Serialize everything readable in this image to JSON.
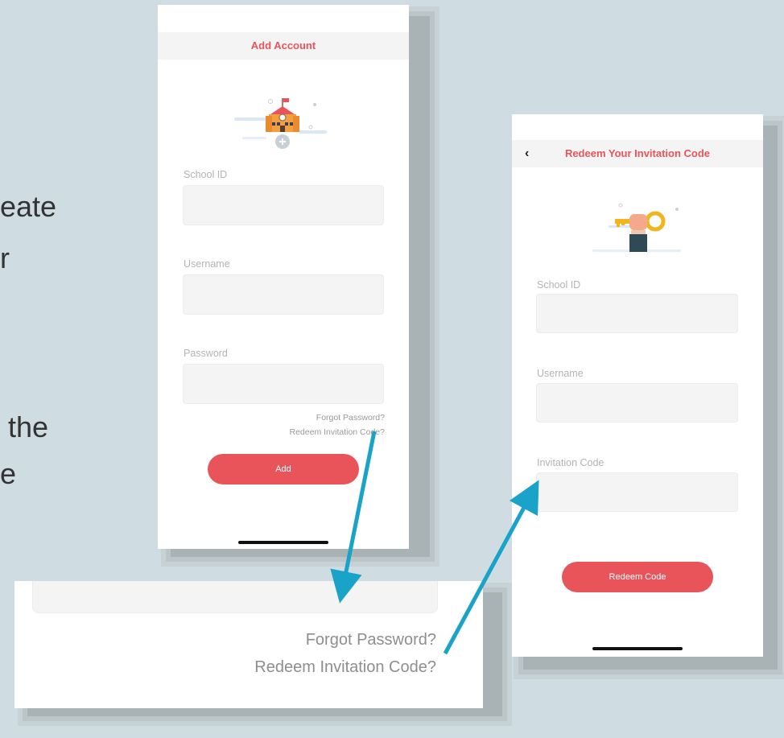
{
  "slide": {
    "line1": "eate",
    "line2": "r",
    "line3": " the",
    "line4": "e"
  },
  "add_account": {
    "title": "Add Account",
    "school_id_label": "School ID",
    "username_label": "Username",
    "password_label": "Password",
    "forgot_password": "Forgot Password?",
    "redeem_link": "Redeem Invitation Code?",
    "add_button": "Add"
  },
  "zoom_callout": {
    "forgot_password": "Forgot Password?",
    "redeem_link": "Redeem Invitation Code?"
  },
  "redeem": {
    "back_glyph": "‹",
    "title": "Redeem Your Invitation Code",
    "school_id_label": "School ID",
    "username_label": "Username",
    "invitation_label": "Invitation Code",
    "redeem_button": "Redeem Code"
  },
  "colors": {
    "accent": "#e8545a",
    "arrow": "#1aa3c8",
    "background": "#cfdde2"
  },
  "icons": {
    "school": "school-building-icon",
    "key": "hand-key-icon"
  }
}
